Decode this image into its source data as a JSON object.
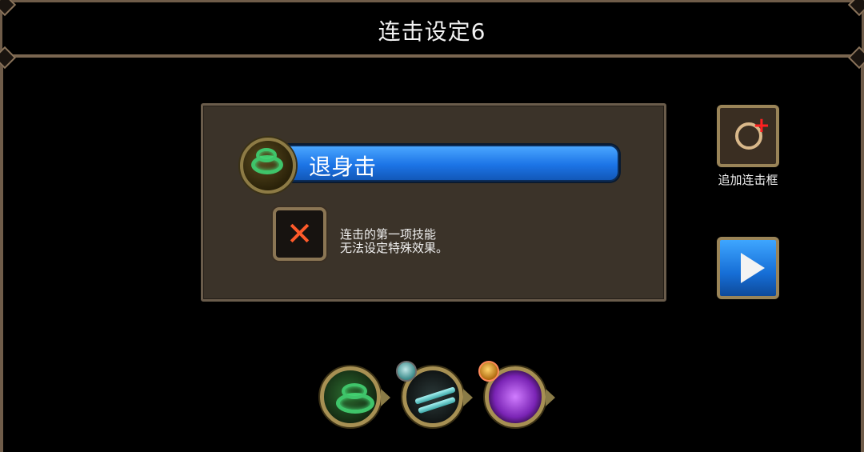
{
  "window": {
    "title": "连击设定6"
  },
  "skill": {
    "name": "退身击"
  },
  "notice": {
    "line1": "连击的第一项技能",
    "line2": "无法设定特殊效果。",
    "mark": "✕"
  },
  "side": {
    "add_frame_label": "追加连击框",
    "plus_glyph": "+",
    "play_icon": "play-icon"
  },
  "combo": {
    "slots": [
      {
        "icon": "green-swirl-skill-icon"
      },
      {
        "icon": "twin-blade-skill-icon",
        "badge_icon": "potion-badge-icon"
      },
      {
        "icon": "purple-burst-skill-icon",
        "badge_icon": "fist-badge-icon"
      }
    ]
  },
  "colors": {
    "accent_blue": "#1c74e6",
    "frame_bronze": "#8b7654",
    "panel_bg": "#3b3329",
    "x_red": "#ff5a2a"
  }
}
